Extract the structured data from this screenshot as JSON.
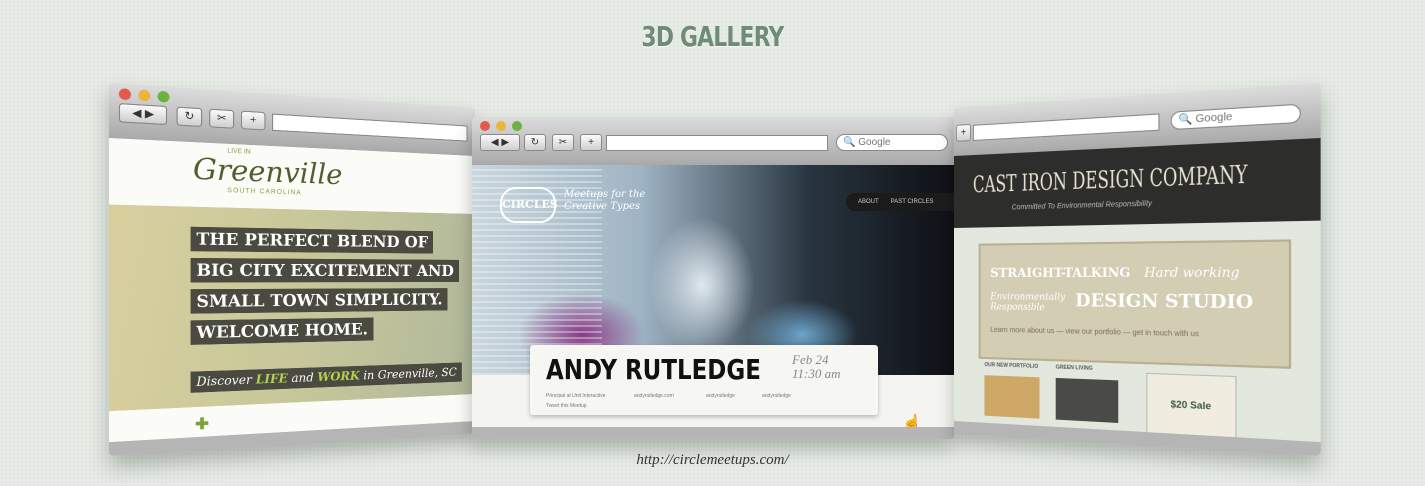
{
  "header": {
    "title": "3D GALLERY"
  },
  "caption": {
    "url": "http://circlemeetups.com/"
  },
  "browser": {
    "search_placeholder": "Google",
    "back": "◀",
    "forward": "▶",
    "reload": "↻",
    "add": "+"
  },
  "left_site": {
    "logo_small": "LIVE IN",
    "logo": "Greenville",
    "logo_sub": "SOUTH CAROLINA",
    "hero_lines": [
      "THE PERFECT BLEND OF",
      "BIG CITY EXCITEMENT AND",
      "SMALL TOWN SIMPLICITY.",
      "WELCOME HOME."
    ],
    "discover_prefix": "Discover",
    "discover_life": "LIFE",
    "discover_and": "and",
    "discover_work": "WORK",
    "discover_suffix": "in Greenville, SC"
  },
  "center_site": {
    "logo": "CIRCLES",
    "tagline": "Meetups for the Creative Types",
    "nav": [
      "ABOUT",
      "PAST CIRCLES"
    ],
    "speaker": "ANDY RUTLEDGE",
    "date": "Feb 24",
    "time": "11:30 am",
    "meta": [
      "Principal at Unit Interactive",
      "andyrutledge.com",
      "andyrutledge",
      "andyrutledge",
      "Tweet this Meetup"
    ]
  },
  "right_site": {
    "title": "CAST IRON DESIGN COMPANY",
    "motto": "Committed To Environmental Responsibility",
    "line1": "STRAIGHT-TALKING",
    "line2": "Hard working",
    "line3": "Environmentally Responsible",
    "line4": "DESIGN STUDIO",
    "links": "Learn more about us — view our portfolio — get in touch with us",
    "col1": "OUR NEW PORTFOLIO",
    "col2": "GREEN LIVING",
    "sale": "$20 Sale"
  }
}
